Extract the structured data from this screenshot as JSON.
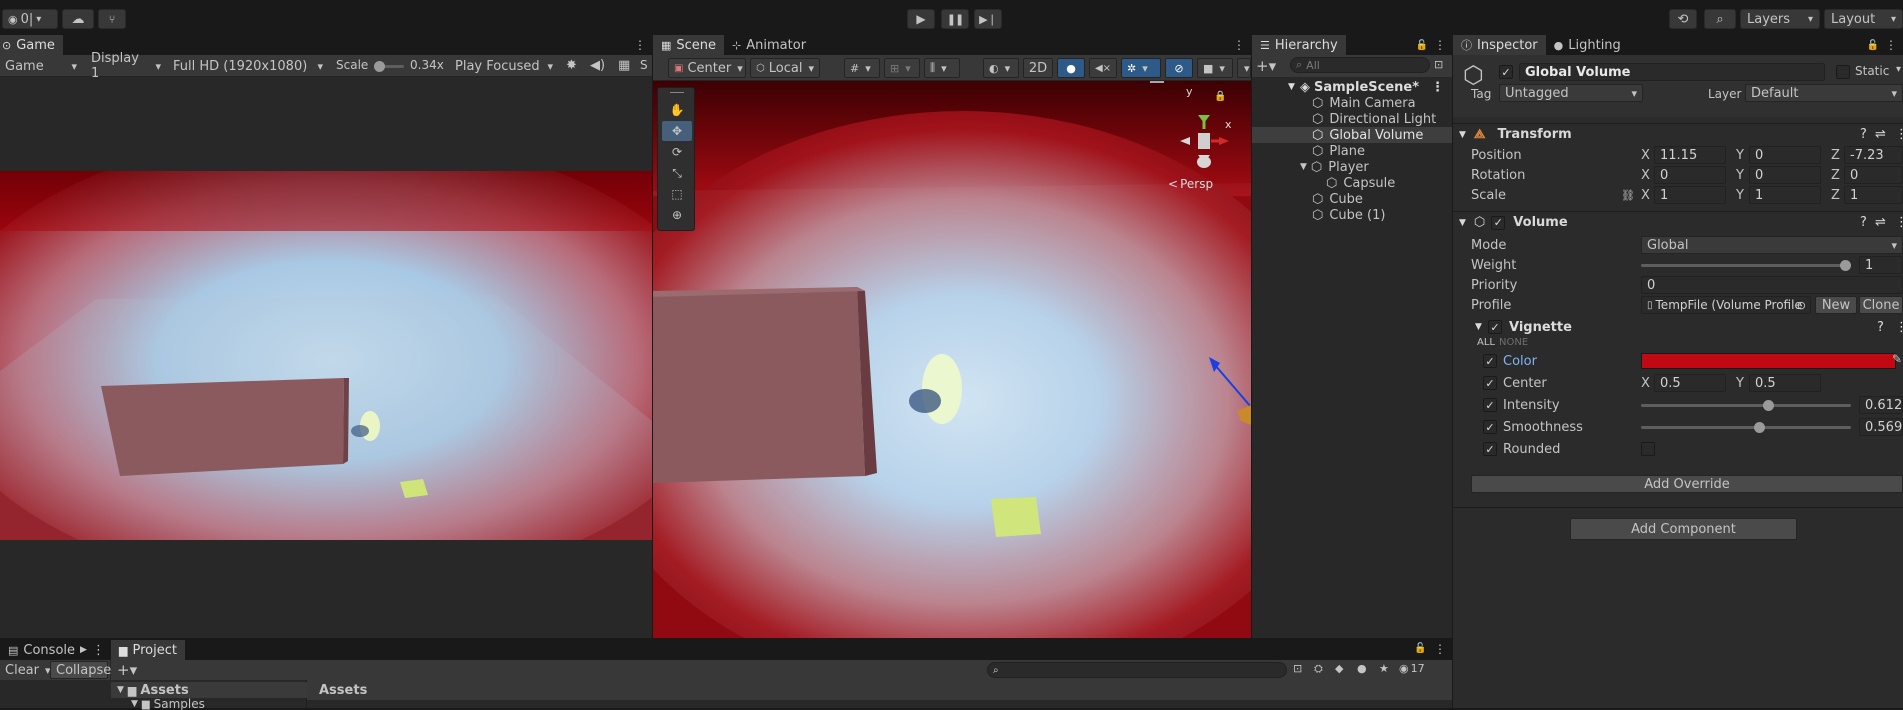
{
  "toolbar": {
    "account_label": "0|",
    "search_icon": "search-icon",
    "layers_label": "Layers",
    "layout_label": "Layout"
  },
  "game": {
    "tab_label": "Game",
    "mode": "Game",
    "display": "Display 1",
    "resolution": "Full HD (1920x1080)",
    "scale_label": "Scale",
    "scale_value": "0.34x",
    "play_mode": "Play Focused",
    "s_label": "S"
  },
  "scene": {
    "tab_scene": "Scene",
    "tab_animator": "Animator",
    "pivot": "Center",
    "space": "Local",
    "mode_2d": "2D",
    "gizmo_y": "y",
    "gizmo_x": "x",
    "persp": "Persp"
  },
  "hierarchy": {
    "tab_label": "Hierarchy",
    "search_placeholder": "All",
    "scene_name": "SampleScene*",
    "items": [
      {
        "label": "Main Camera"
      },
      {
        "label": "Directional Light"
      },
      {
        "label": "Global Volume"
      },
      {
        "label": "Plane"
      },
      {
        "label": "Player"
      },
      {
        "label": "Capsule"
      },
      {
        "label": "Cube"
      },
      {
        "label": "Cube (1)"
      }
    ]
  },
  "inspector": {
    "tab_inspector": "Inspector",
    "tab_lighting": "Lighting",
    "object_name": "Global Volume",
    "static_label": "Static",
    "tag_label": "Tag",
    "tag_value": "Untagged",
    "layer_label": "Layer",
    "layer_value": "Default",
    "transform": {
      "title": "Transform",
      "position_label": "Position",
      "rotation_label": "Rotation",
      "scale_label": "Scale",
      "x": "X",
      "y": "Y",
      "z": "Z",
      "position": [
        "11.15",
        "0",
        "-7.23"
      ],
      "rotation": [
        "0",
        "0",
        "0"
      ],
      "scale": [
        "1",
        "1",
        "1"
      ]
    },
    "volume": {
      "title": "Volume",
      "mode_label": "Mode",
      "mode_value": "Global",
      "weight_label": "Weight",
      "weight_value": "1",
      "weight_fraction": 1.0,
      "priority_label": "Priority",
      "priority_value": "0",
      "profile_label": "Profile",
      "profile_value": "TempFile (Volume Profile",
      "new_label": "New",
      "clone_label": "Clone"
    },
    "vignette": {
      "title": "Vignette",
      "all_label": "ALL",
      "none_label": "NONE",
      "color_label": "Color",
      "color_value": "#c00912",
      "center_label": "Center",
      "center_x": "0.5",
      "center_y": "0.5",
      "intensity_label": "Intensity",
      "intensity_value": "0.612",
      "intensity_fraction": 0.612,
      "smoothness_label": "Smoothness",
      "smoothness_value": "0.569",
      "smoothness_fraction": 0.569,
      "rounded_label": "Rounded"
    },
    "add_override": "Add Override",
    "add_component": "Add Component"
  },
  "console": {
    "tab_label": "Console",
    "clear_label": "Clear",
    "collapse_label": "Collapse"
  },
  "project": {
    "tab_label": "Project",
    "assets_label": "Assets",
    "breadcrumb": "Assets",
    "samples_label": "Samples",
    "badge_count": "17"
  },
  "colors": {
    "accent_blue": "#2d5a88",
    "vignette_red": "#c00912"
  }
}
